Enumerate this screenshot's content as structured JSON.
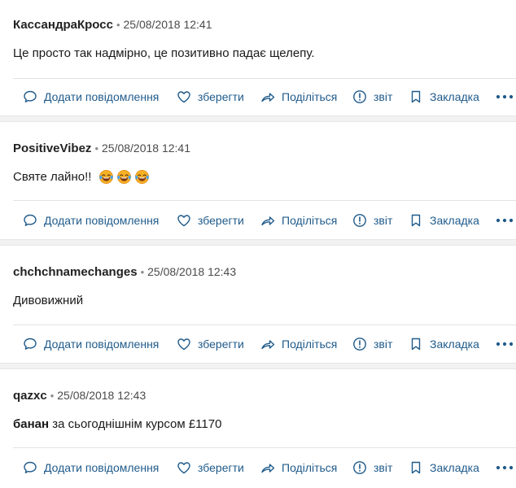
{
  "ui": {
    "dot": "•",
    "colors": {
      "action_blue": "#1f5a8a",
      "separator_gray": "#f2f2f2"
    },
    "actions": {
      "add_comment": "Додати повідомлення",
      "save": "зберегти",
      "share": "Поділіться",
      "report": "звіт",
      "bookmark": "Закладка"
    },
    "action_icons": [
      "speech-bubble-icon",
      "heart-icon",
      "share-arrow-icon",
      "info-circle-icon",
      "bookmark-icon",
      "more-dots-icon"
    ]
  },
  "comments": [
    {
      "author": "КассандраКросс",
      "timestamp": "25/08/2018 12:41",
      "text": "Це просто так надмірно, це позитивно падає щелепу."
    },
    {
      "author": "PositiveVibez",
      "timestamp": "25/08/2018 12:41",
      "text": "Святе лайно!!",
      "emojis": [
        "laughing-crying-emoji",
        "laughing-crying-emoji",
        "laughing-crying-emoji"
      ]
    },
    {
      "author": "chchchnamechanges",
      "timestamp": "25/08/2018 12:43",
      "text": "Дивовижний"
    },
    {
      "author": "qazxc",
      "timestamp": "25/08/2018 12:43",
      "text_bold": "банан",
      "text_rest": " за сьогоднішнім курсом £1170"
    }
  ]
}
